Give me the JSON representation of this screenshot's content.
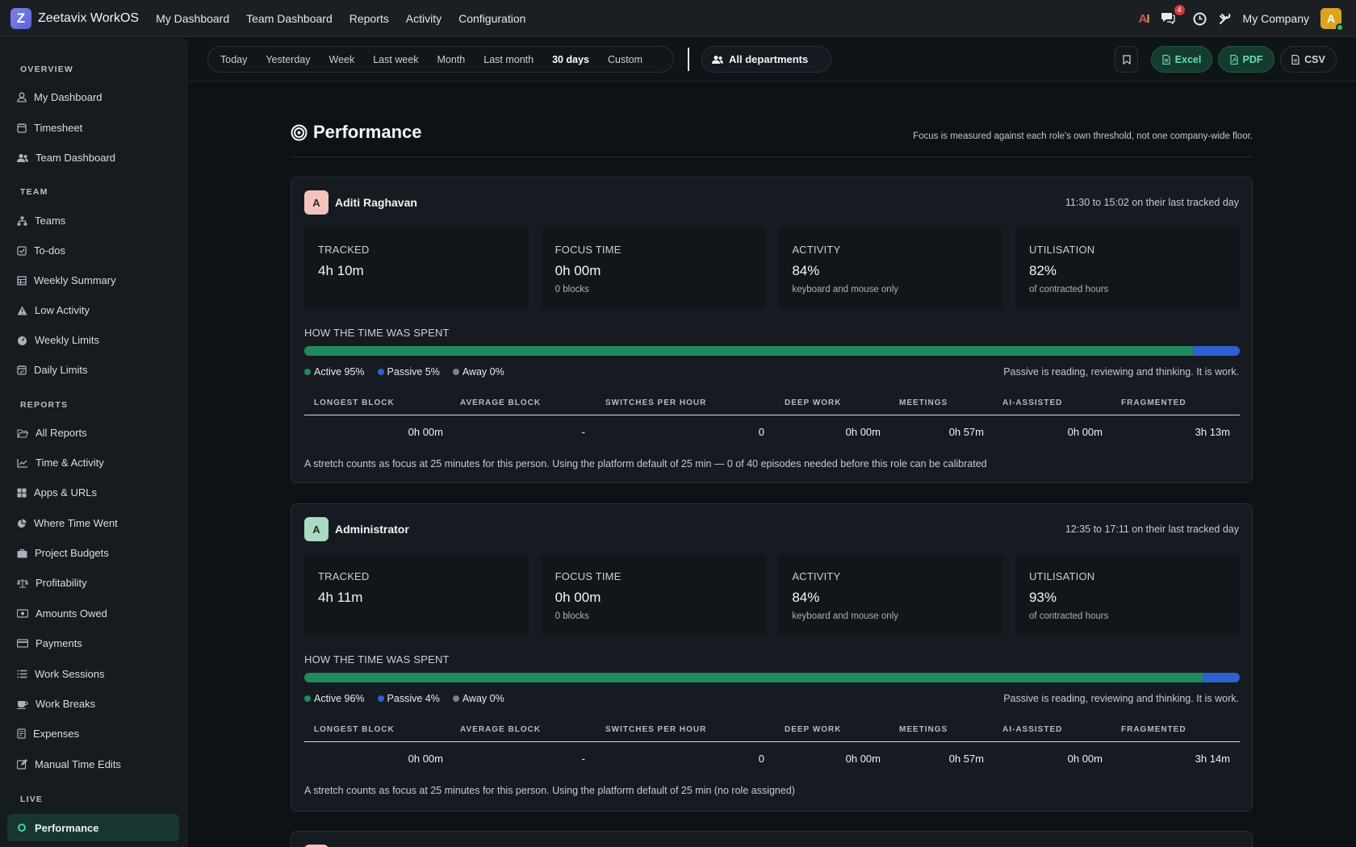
{
  "app": {
    "title": "Zeetavix WorkOS",
    "logo_letter": "Z"
  },
  "topnav": [
    "My Dashboard",
    "Team Dashboard",
    "Reports",
    "Activity",
    "Configuration"
  ],
  "topbar": {
    "ai_label_a": "A",
    "ai_label_i": "I",
    "chat_badge": "4",
    "company": "My Company",
    "avatar_letter": "A"
  },
  "sidebar": {
    "overview_label": "OVERVIEW",
    "overview": [
      "My Dashboard",
      "Timesheet",
      "Team Dashboard"
    ],
    "team_label": "TEAM",
    "team": [
      "Teams",
      "To-dos",
      "Weekly Summary",
      "Low Activity",
      "Weekly Limits",
      "Daily Limits"
    ],
    "reports_label": "REPORTS",
    "reports": [
      "All Reports",
      "Time & Activity",
      "Apps & URLs",
      "Where Time Went",
      "Project Budgets",
      "Profitability",
      "Amounts Owed",
      "Payments",
      "Work Sessions",
      "Work Breaks",
      "Expenses",
      "Manual Time Edits"
    ],
    "live_label": "LIVE",
    "live_active": "Performance"
  },
  "filters": {
    "ranges": [
      "Today",
      "Yesterday",
      "Week",
      "Last week",
      "Month",
      "Last month",
      "30 days",
      "Custom"
    ],
    "active_range": "30 days",
    "department": "All departments",
    "export": {
      "excel": "Excel",
      "pdf": "PDF",
      "csv": "CSV"
    }
  },
  "page": {
    "title": "Performance",
    "note": "Focus is measured against each role's own threshold, not one company-wide floor."
  },
  "labels": {
    "tracked": "TRACKED",
    "focus": "FOCUS TIME",
    "activity": "ACTIVITY",
    "utilisation": "UTILISATION",
    "spent": "HOW THE TIME WAS SPENT",
    "passive_note": "Passive is reading, reviewing and thinking. It is work.",
    "activity_sub": "keyboard and mouse only",
    "util_sub": "of contracted hours",
    "metric_headers": [
      "LONGEST BLOCK",
      "AVERAGE BLOCK",
      "SWITCHES PER HOUR",
      "DEEP WORK",
      "MEETINGS",
      "AI-ASSISTED",
      "FRAGMENTED"
    ]
  },
  "colors": {
    "active": "#1f8a5e",
    "passive": "#2f5fd0",
    "away": "#7a8288",
    "accent": "#3ad6a6"
  },
  "people": [
    {
      "initial": "A",
      "name": "Aditi Raghavan",
      "avatar_color": "#f3c3bd",
      "last_day": "11:30 to 15:02 on their last tracked day",
      "tracked": "4h 10m",
      "focus": "0h 00m",
      "focus_sub": "0 blocks",
      "activity": "84%",
      "utilisation": "82%",
      "active_pct": 95,
      "passive_pct": 5,
      "away_pct": 0,
      "legend": {
        "active": "Active 95%",
        "passive": "Passive 5%",
        "away": "Away 0%"
      },
      "metrics": [
        "0h 00m",
        "-",
        "0",
        "0h 00m",
        "0h 57m",
        "0h 00m",
        "3h 13m"
      ],
      "footnote": "A stretch counts as focus at 25 minutes for this person. Using the platform default of 25 min — 0 of 40 episodes needed before this role can be calibrated"
    },
    {
      "initial": "A",
      "name": "Administrator",
      "avatar_color": "#a8dcc0",
      "last_day": "12:35 to 17:11 on their last tracked day",
      "tracked": "4h 11m",
      "focus": "0h 00m",
      "focus_sub": "0 blocks",
      "activity": "84%",
      "utilisation": "93%",
      "active_pct": 96,
      "passive_pct": 4,
      "away_pct": 0,
      "legend": {
        "active": "Active 96%",
        "passive": "Passive 4%",
        "away": "Away 0%"
      },
      "metrics": [
        "0h 00m",
        "-",
        "0",
        "0h 00m",
        "0h 57m",
        "0h 00m",
        "3h 14m"
      ],
      "footnote": "A stretch counts as focus at 25 minutes for this person. Using the platform default of 25 min (no role assigned)"
    }
  ]
}
